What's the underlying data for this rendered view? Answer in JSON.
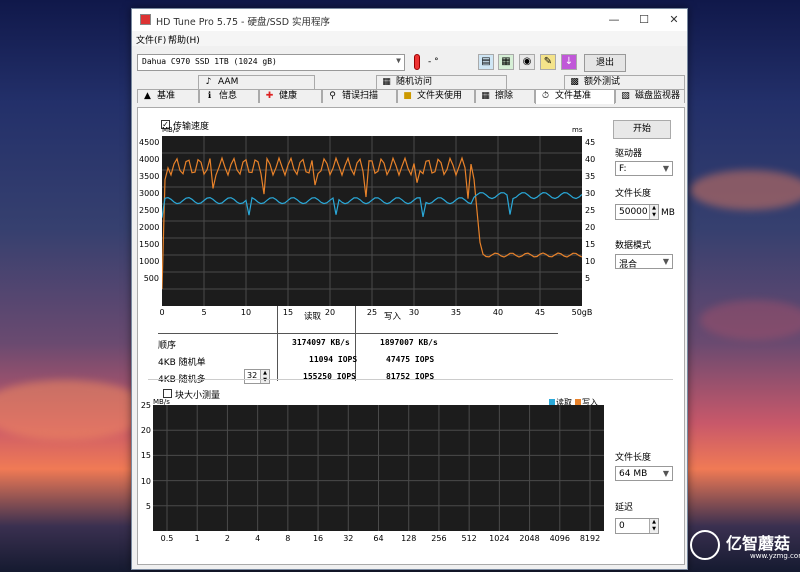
{
  "window": {
    "title": "HD Tune Pro 5.75 - 硬盘/SSD 实用程序"
  },
  "menu": [
    "文件(F)",
    "帮助(H)"
  ],
  "toolbar": {
    "drive": "Dahua C970 SSD 1TB (1024 gB)",
    "temperature": "- °",
    "exit": "退出"
  },
  "tabs_top": [
    "AAM",
    "随机访问",
    "额外测试"
  ],
  "tabs_bottom": [
    "基准",
    "信息",
    "健康",
    "错误扫描",
    "文件夹使用",
    "擦除",
    "文件基准",
    "磁盘监视器"
  ],
  "benchmark": {
    "transfer_label": "传输速度",
    "y_left_unit": "MB/s",
    "y_right_unit": "ms",
    "y_left_ticks": [
      "4500",
      "4000",
      "3500",
      "3000",
      "2500",
      "2000",
      "1500",
      "1000",
      "500"
    ],
    "y_right_ticks": [
      "45",
      "40",
      "35",
      "30",
      "25",
      "20",
      "15",
      "10",
      "5"
    ],
    "x_ticks": [
      "0",
      "5",
      "10",
      "15",
      "20",
      "25",
      "30",
      "35",
      "40",
      "45",
      "50gB"
    ],
    "results": {
      "col_read": "读取",
      "col_write": "写入",
      "rows": [
        {
          "label": "顺序",
          "read": "3174097 KB/s",
          "write": "1897007 KB/s"
        },
        {
          "label": "4KB 随机单",
          "read": "11094 IOPS",
          "write": "47475 IOPS"
        },
        {
          "label": "4KB 随机多",
          "read": "155250 IOPS",
          "write": "81752 IOPS"
        }
      ],
      "queue_depth": "32"
    }
  },
  "side": {
    "start": "开始",
    "drive_label": "驱动器",
    "drive_value": "F:",
    "file_len_label": "文件长度",
    "file_len_value": "50000",
    "file_len_unit": "MB",
    "data_mode_label": "数据模式",
    "data_mode_value": "混合"
  },
  "block": {
    "label": "块大小测量",
    "y_unit": "MB/s",
    "legend_read": "读取",
    "legend_write": "写入",
    "y_ticks": [
      "25",
      "20",
      "15",
      "10",
      "5"
    ],
    "x_ticks": [
      "0.5",
      "1",
      "2",
      "4",
      "8",
      "16",
      "32",
      "64",
      "128",
      "256",
      "512",
      "1024",
      "2048",
      "4096",
      "8192"
    ],
    "file_len_label": "文件长度",
    "file_len_value": "64 MB",
    "delay_label": "延迟",
    "delay_value": "0"
  },
  "colors": {
    "read": "#2aa8d8",
    "write": "#e8822a",
    "chart_bg": "#1c1c1c",
    "grid": "#4a4a4a"
  },
  "watermark": {
    "text": "亿智蘑菇",
    "url": "www.yzmg.com"
  }
}
